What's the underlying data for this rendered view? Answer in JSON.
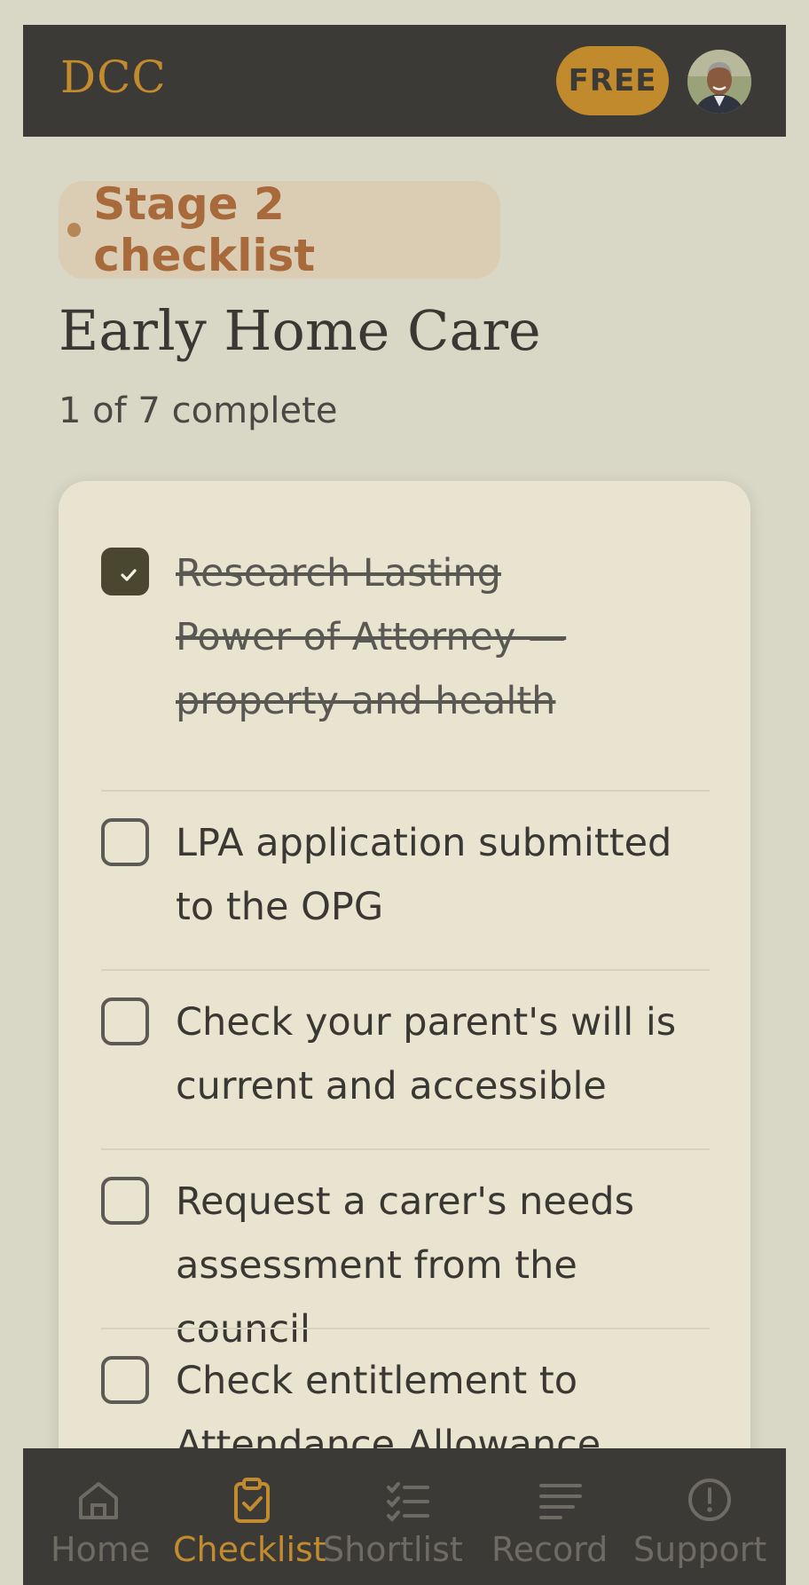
{
  "header": {
    "logo": "DCC",
    "plan_badge": "FREE",
    "avatar_icon": "user-avatar-photo"
  },
  "stage": {
    "label": "Stage 2 checklist"
  },
  "page": {
    "title": "Early Home Care",
    "progress": "1 of 7 complete",
    "completed": 1,
    "total": 7
  },
  "checklist": [
    {
      "text": "Research Lasting Power of Attorney — property and health",
      "checked": true
    },
    {
      "text": "LPA application submitted to the OPG",
      "checked": false
    },
    {
      "text": "Check your parent's will is current and accessible",
      "checked": false
    },
    {
      "text": "Request a carer's needs assessment from the council",
      "checked": false
    },
    {
      "text": "Check entitlement to Attendance Allowance",
      "checked": false
    }
  ],
  "nav": {
    "items": [
      {
        "label": "Home",
        "icon": "home-icon",
        "active": false
      },
      {
        "label": "Checklist",
        "icon": "clipboard-check-icon",
        "active": true
      },
      {
        "label": "Shortlist",
        "icon": "list-check-icon",
        "active": false
      },
      {
        "label": "Record",
        "icon": "lines-icon",
        "active": false
      },
      {
        "label": "Support",
        "icon": "alert-circle-icon",
        "active": false
      }
    ]
  },
  "colors": {
    "background": "#d9d8c7",
    "header": "#3c3a36",
    "accent": "#c28b2e",
    "card": "#e8e4cf",
    "stage_text": "#a8693b"
  }
}
